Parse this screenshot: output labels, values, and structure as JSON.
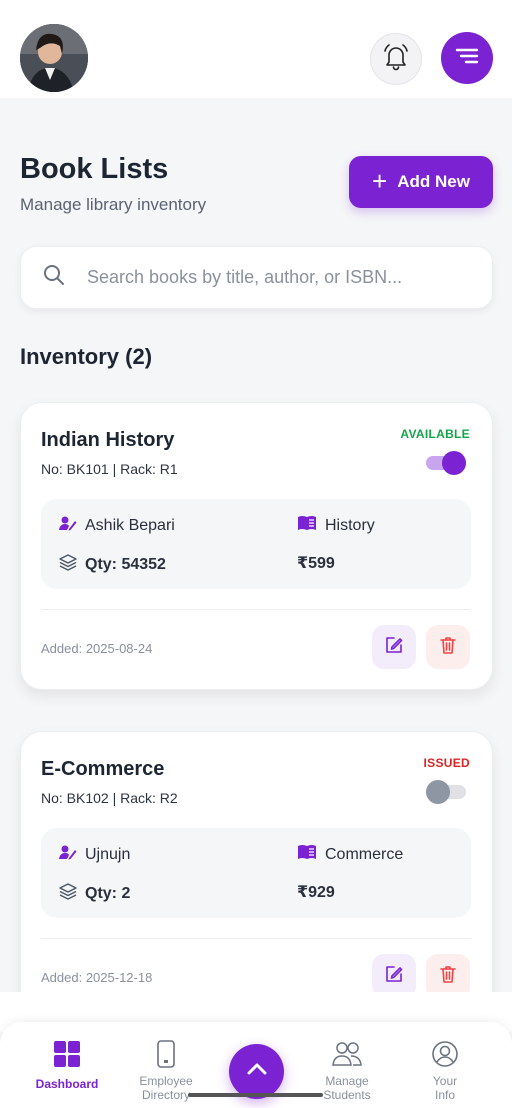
{
  "header": {
    "avatar_alt": "User avatar",
    "notification_icon": "bell-icon",
    "menu_icon": "menu-icon"
  },
  "page": {
    "title": "Book Lists",
    "subtitle": "Manage library inventory",
    "add_button_label": "Add New"
  },
  "search": {
    "placeholder": "Search books by title, author, or ISBN..."
  },
  "inventory": {
    "heading": "Inventory (2)",
    "books": [
      {
        "title": "Indian History",
        "meta": "No: BK101 | Rack: R1",
        "status": "AVAILABLE",
        "status_color": "#16a34a",
        "toggle_on": true,
        "author": "Ashik Bepari",
        "category": "History",
        "qty": "Qty: 54352",
        "price": "₹599",
        "added": "Added: 2025-08-24"
      },
      {
        "title": "E-Commerce",
        "meta": "No: BK102 | Rack: R2",
        "status": "ISSUED",
        "status_color": "#dc2626",
        "toggle_on": false,
        "author": "Ujnujn",
        "category": "Commerce",
        "qty": "Qty: 2",
        "price": "₹929",
        "added": "Added: 2025-12-18"
      }
    ]
  },
  "bottom_nav": {
    "items": [
      {
        "label": "Dashboard",
        "icon": "grid-icon",
        "active": true
      },
      {
        "label": "Employee Directory",
        "icon": "phone-icon",
        "active": false
      },
      {
        "label": "Manage Students",
        "icon": "users-icon",
        "active": false
      },
      {
        "label": "Your Info",
        "icon": "user-circle-icon",
        "active": false
      }
    ],
    "fab_icon": "chevron-up-icon"
  },
  "colors": {
    "accent": "#7b22d3",
    "available": "#16a34a",
    "issued": "#dc2626",
    "delete": "#ef4444"
  }
}
